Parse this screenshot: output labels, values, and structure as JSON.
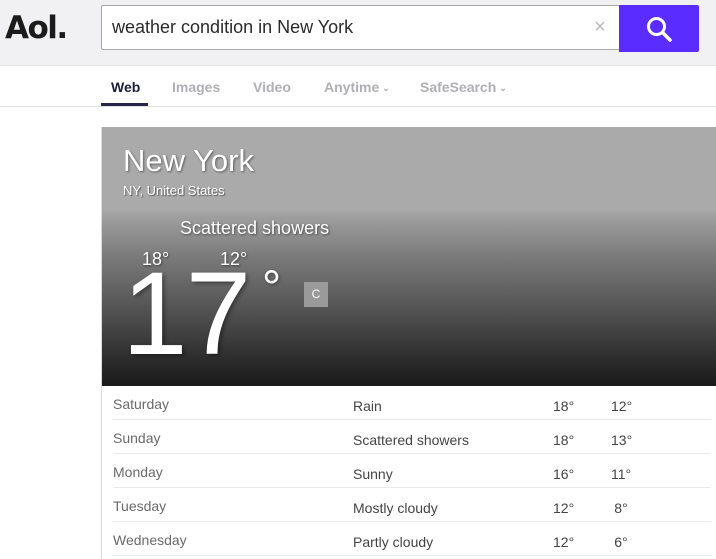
{
  "header": {
    "logo": "Aol.",
    "search": {
      "value": "weather condition in New York",
      "placeholder": ""
    },
    "clear_icon": "×",
    "search_button_icon": "search-icon",
    "accent_color": "#5a2cff"
  },
  "nav": {
    "tabs": [
      {
        "label": "Web",
        "active": true
      },
      {
        "label": "Images",
        "active": false
      },
      {
        "label": "Video",
        "active": false
      },
      {
        "label": "Anytime",
        "active": false,
        "dropdown": true
      },
      {
        "label": "SafeSearch",
        "active": false,
        "dropdown": true
      }
    ],
    "dropdown_glyph": "⌄"
  },
  "weather": {
    "city": "New York",
    "region": "NY, United States",
    "condition": "Scattered showers",
    "high": "18°",
    "low": "12°",
    "current_temp": "17",
    "degree_symbol": "°",
    "unit": "C",
    "forecast": [
      {
        "day": "Saturday",
        "condition": "Rain",
        "high": "18°",
        "low": "12°"
      },
      {
        "day": "Sunday",
        "condition": "Scattered showers",
        "high": "18°",
        "low": "13°"
      },
      {
        "day": "Monday",
        "condition": "Sunny",
        "high": "16°",
        "low": "11°"
      },
      {
        "day": "Tuesday",
        "condition": "Mostly cloudy",
        "high": "12°",
        "low": "8°"
      },
      {
        "day": "Wednesday",
        "condition": "Partly cloudy",
        "high": "12°",
        "low": "6°"
      }
    ]
  }
}
